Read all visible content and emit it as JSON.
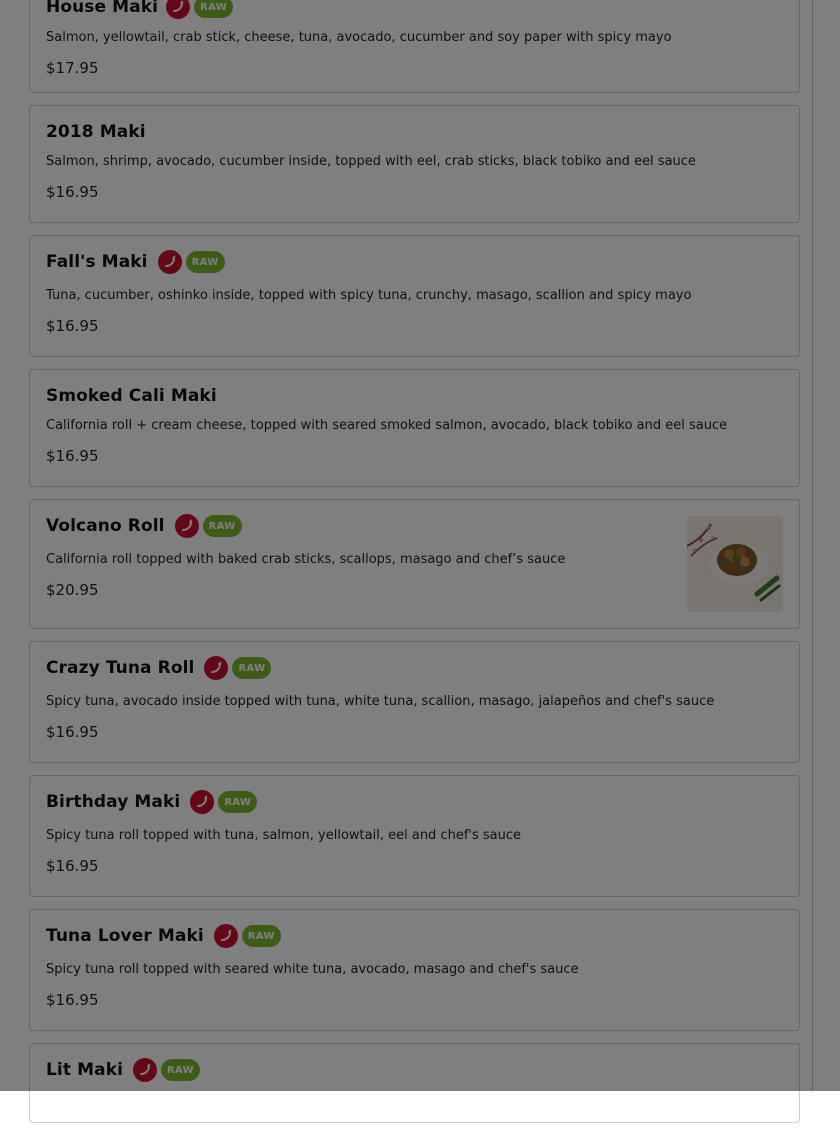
{
  "menu": {
    "items": [
      {
        "name": "House Maki",
        "spicy": true,
        "raw": true,
        "raw_label": "RAW",
        "description": "Salmon, yellowtail, crab stick, cheese, tuna, avocado, cucumber and soy paper with spicy mayo",
        "price": "$17.95"
      },
      {
        "name": "2018 Maki",
        "spicy": false,
        "raw": false,
        "description": "Salmon, shrimp, avocado, cucumber inside, topped with eel, crab sticks, black tobiko and eel sauce",
        "price": "$16.95"
      },
      {
        "name": "Fall's Maki",
        "spicy": true,
        "raw": true,
        "raw_label": "RAW",
        "description": "Tuna, cucumber, oshinko inside, topped with spicy tuna, crunchy, masago, scallion and spicy mayo",
        "price": "$16.95"
      },
      {
        "name": "Smoked Cali Maki",
        "spicy": false,
        "raw": false,
        "description": "California roll + cream cheese, topped with seared smoked salmon, avocado, black tobiko and eel sauce",
        "price": "$16.95"
      },
      {
        "name": "Volcano Roll",
        "spicy": true,
        "raw": true,
        "raw_label": "RAW",
        "description": "California roll topped with baked crab sticks, scallops, masago and chef’s sauce",
        "price": "$20.95",
        "has_image": true
      },
      {
        "name": "Crazy Tuna Roll",
        "spicy": true,
        "raw": true,
        "raw_label": "RAW",
        "description": "Spicy tuna, avocado inside topped with tuna, white tuna, scallion, masago, jalapeños and chef's sauce",
        "price": "$16.95"
      },
      {
        "name": "Birthday Maki",
        "spicy": true,
        "raw": true,
        "raw_label": "RAW",
        "description": "Spicy tuna roll topped with tuna, salmon, yellowtail, eel and chef's sauce",
        "price": "$16.95"
      },
      {
        "name": "Tuna Lover Maki",
        "spicy": true,
        "raw": true,
        "raw_label": "RAW",
        "description": "Spicy tuna roll topped with seared white tuna, avocado, masago and chef's sauce",
        "price": "$16.95"
      },
      {
        "name": "Lit Maki",
        "spicy": true,
        "raw": true,
        "raw_label": "RAW",
        "description": "",
        "price": ""
      }
    ]
  },
  "icons": {
    "spicy": "chili-pepper-icon",
    "raw": "raw-badge"
  },
  "colors": {
    "spicy_red": "#c8102e",
    "raw_green": "#7cb82f",
    "overlay": "rgba(0,0,0,0.5)"
  }
}
